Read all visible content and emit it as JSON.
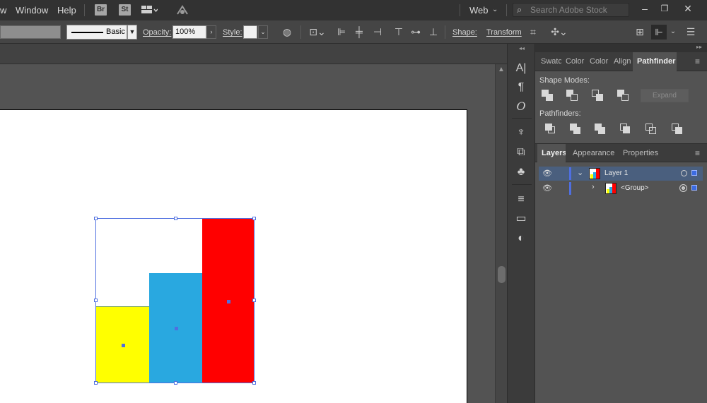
{
  "menubar": {
    "items": [
      "w",
      "Window",
      "Help"
    ],
    "bridge_label": "Br",
    "stock_label": "St",
    "workspace": "Web",
    "search_placeholder": "Search Adobe Stock"
  },
  "controlbar": {
    "stroke_style": "Basic",
    "opacity_label": "Opacity:",
    "opacity_value": "100%",
    "style_label": "Style:",
    "shape_label": "Shape:",
    "transform_label": "Transform"
  },
  "artwork": {
    "bars": [
      {
        "name": "yellow-bar",
        "color": "#FFFF00"
      },
      {
        "name": "blue-bar",
        "color": "#29A8E0"
      },
      {
        "name": "red-bar",
        "color": "#FF0000"
      }
    ]
  },
  "pathfinder_panel": {
    "tabs": [
      "Swatc",
      "Color",
      "Color",
      "Align",
      "Pathfinder"
    ],
    "active_tab": "Pathfinder",
    "shape_modes_label": "Shape Modes:",
    "pathfinders_label": "Pathfinders:",
    "expand_label": "Expand"
  },
  "layers_panel": {
    "tabs": [
      "Layers",
      "Appearance",
      "Properties"
    ],
    "active_tab": "Layers",
    "rows": [
      {
        "name": "Layer 1"
      },
      {
        "name": "<Group>"
      }
    ]
  },
  "colors": {
    "selection": "#4F6FE0",
    "ui_dark": "#323232",
    "ui_mid": "#535353"
  }
}
